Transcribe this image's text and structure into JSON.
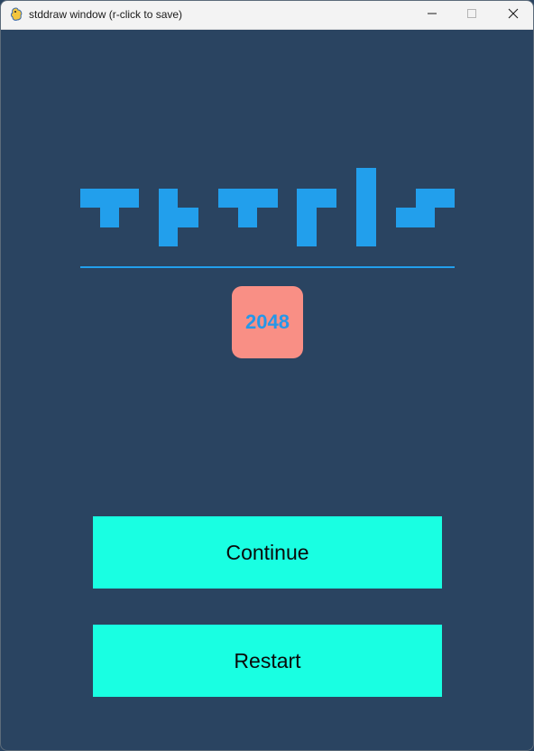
{
  "window": {
    "title": "stddraw window (r-click to save)",
    "app_icon": "pygame-snake-icon",
    "controls": [
      "minimize-icon",
      "maximize-icon",
      "close-icon"
    ]
  },
  "logo": {
    "pieces": [
      "T",
      "T-rotated",
      "T",
      "L-rotated",
      "I",
      "S"
    ],
    "color": "#229fec"
  },
  "score": {
    "value": "2048",
    "tile_color": "#f98f85",
    "text_color": "#2697e8"
  },
  "menu": {
    "continue_label": "Continue",
    "restart_label": "Restart",
    "button_color": "#19ffe2"
  },
  "colors": {
    "background": "#2a4461",
    "accent": "#229fec"
  }
}
